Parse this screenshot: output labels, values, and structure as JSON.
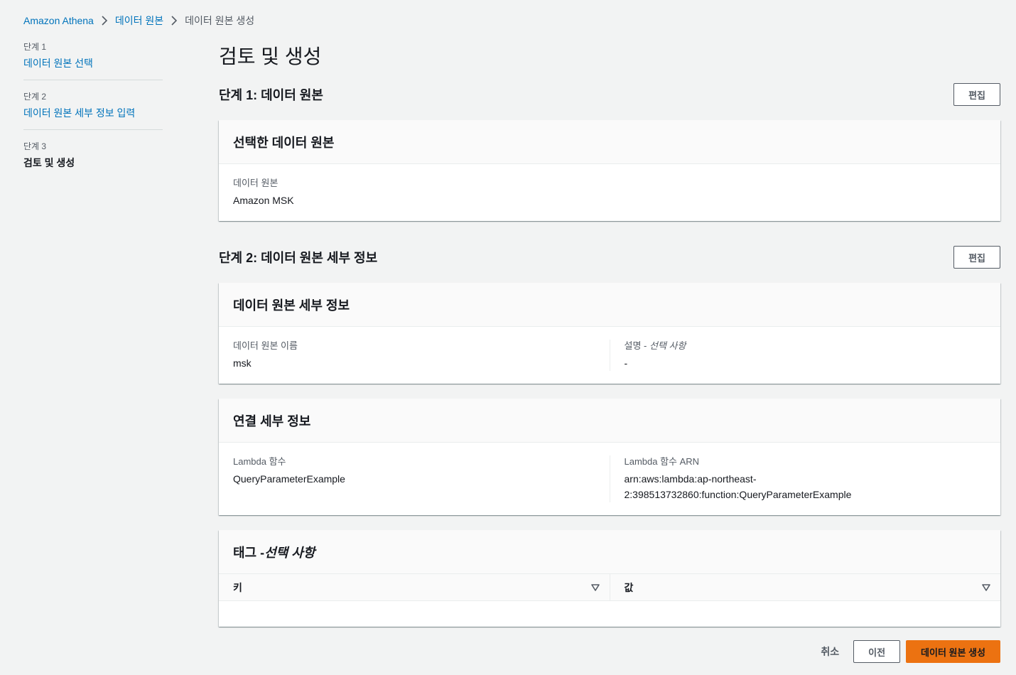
{
  "breadcrumb": {
    "items": [
      "Amazon Athena",
      "데이터 원본",
      "데이터 원본 생성"
    ]
  },
  "steps": [
    {
      "num": "단계 1",
      "label": "데이터 원본 선택"
    },
    {
      "num": "단계 2",
      "label": "데이터 원본 세부 정보 입력"
    },
    {
      "num": "단계 3",
      "label": "검토 및 생성"
    }
  ],
  "page_title": "검토 및 생성",
  "section1": {
    "title": "단계 1: 데이터 원본",
    "edit_label": "편집",
    "card_title": "선택한 데이터 원본",
    "field_label": "데이터 원본",
    "field_value": "Amazon MSK"
  },
  "section2": {
    "title": "단계 2: 데이터 원본 세부 정보",
    "edit_label": "편집",
    "details": {
      "card_title": "데이터 원본 세부 정보",
      "name_label": "데이터 원본 이름",
      "name_value": "msk",
      "desc_label": "설명 - ",
      "desc_label_optional": "선택 사항",
      "desc_value": "-"
    },
    "connection": {
      "card_title": "연결 세부 정보",
      "lambda_label": "Lambda 함수",
      "lambda_value": "QueryParameterExample",
      "arn_label": "Lambda 함수 ARN",
      "arn_value_line1": "arn:aws:lambda:ap-northeast-",
      "arn_value_line2": "2:398513732860:function:QueryParameterExample"
    },
    "tags": {
      "card_title": "태그 - ",
      "card_title_optional": "선택 사항",
      "key_header": "키",
      "value_header": "값"
    }
  },
  "footer": {
    "cancel_label": "취소",
    "previous_label": "이전",
    "create_label": "데이터 원본 생성"
  },
  "colors": {
    "link": "#0073bb",
    "primary": "#ec7211",
    "background": "#f2f3f3"
  }
}
